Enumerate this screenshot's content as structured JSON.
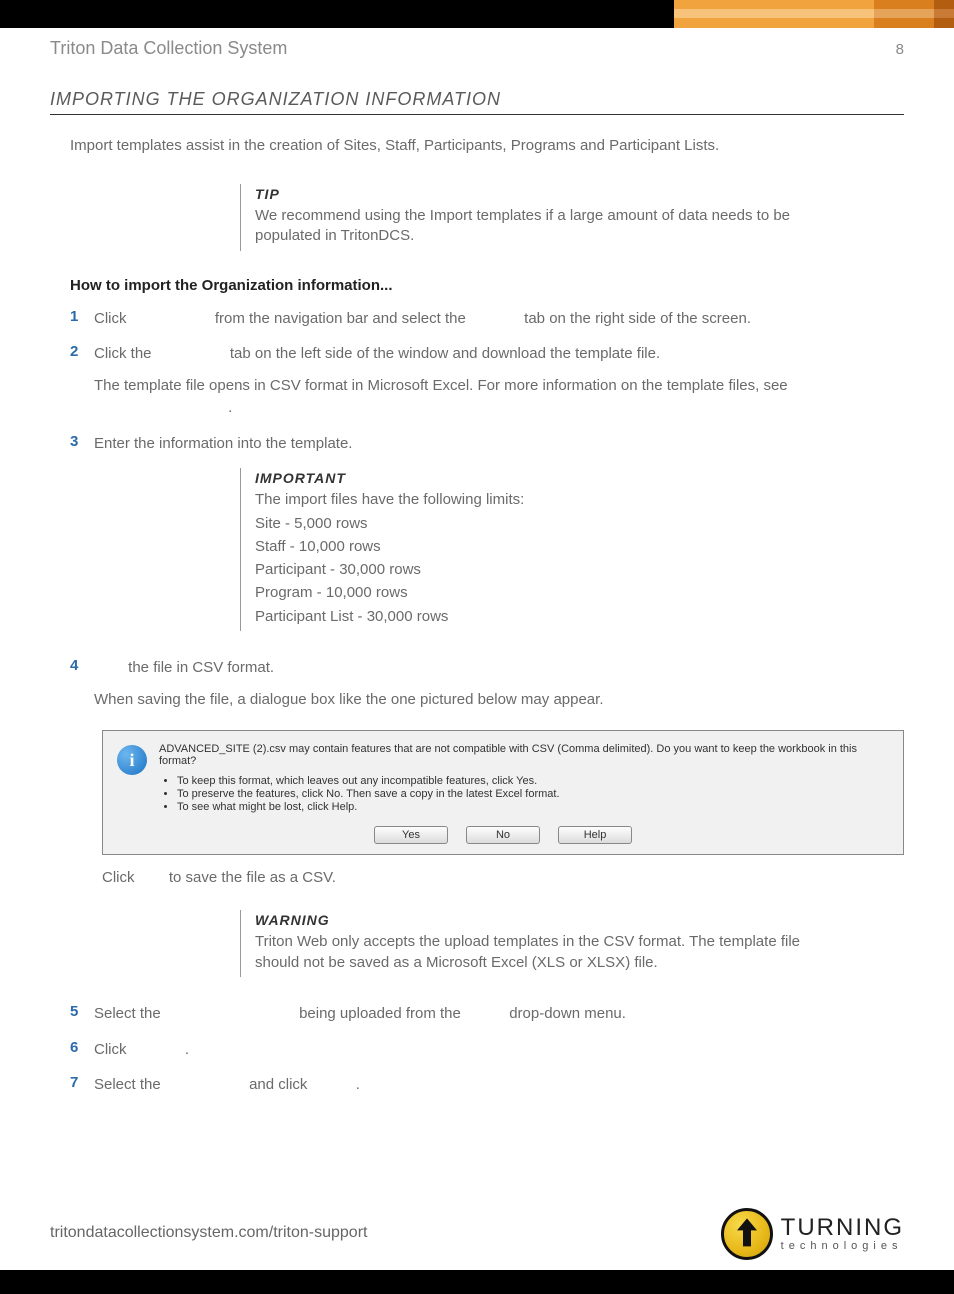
{
  "header": {
    "doc_title": "Triton Data Collection System",
    "page_number": "8"
  },
  "section_title": "IMPORTING THE ORGANIZATION INFORMATION",
  "intro": "Import templates assist in the creation of Sites, Staff, Participants, Programs and Participant Lists.",
  "tip": {
    "label": "TIP",
    "text": "We recommend using the Import templates if a large amount of data needs to be populated in TritonDCS."
  },
  "howto_title": "How to import the Organization information...",
  "steps": {
    "s1": {
      "a": "Click ",
      "b": " from the navigation bar and select the ",
      "c": " tab on the right side of the screen."
    },
    "s2": {
      "a": "Click the ",
      "b": " tab on the left side of the window and download the template file.",
      "sub": "The template file opens in CSV format in Microsoft Excel. For more information on the template files, see",
      "sub2": "."
    },
    "s3": {
      "a": "Enter the information into the template."
    },
    "important": {
      "label": "IMPORTANT",
      "lead": "The import files have the following limits:",
      "limits": [
        "Site - 5,000 rows",
        "Staff - 10,000 rows",
        "Participant - 30,000 rows",
        "Program - 10,000 rows",
        "Participant List - 30,000 rows"
      ]
    },
    "s4": {
      "a": " the file in CSV format.",
      "sub": "When saving the file, a dialogue box like the one pictured below may appear."
    },
    "after_dialog": {
      "a": "Click ",
      "b": " to save the file as a CSV."
    },
    "warning": {
      "label": "WARNING",
      "text": "Triton Web only accepts the upload templates in the CSV format. The template file should not be saved as a Microsoft Excel (XLS or XLSX) file."
    },
    "s5": {
      "a": "Select the ",
      "b": " being uploaded from the ",
      "c": " drop-down menu."
    },
    "s6": {
      "a": "Click ",
      "b": "."
    },
    "s7": {
      "a": "Select the ",
      "b": " and click ",
      "c": "."
    }
  },
  "dialog": {
    "question": "ADVANCED_SITE (2).csv may contain features that are not compatible with CSV (Comma delimited).  Do you want to keep the workbook in this format?",
    "bullets": [
      "To keep this format, which leaves out any incompatible features, click Yes.",
      "To preserve the features, click No. Then save a copy in the latest Excel format.",
      "To see what might be lost, click Help."
    ],
    "buttons": {
      "yes": "Yes",
      "no": "No",
      "help": "Help"
    }
  },
  "footer": {
    "url": "tritondatacollectionsystem.com/triton-support",
    "logo_big": "TURNING",
    "logo_small": "technologies"
  }
}
